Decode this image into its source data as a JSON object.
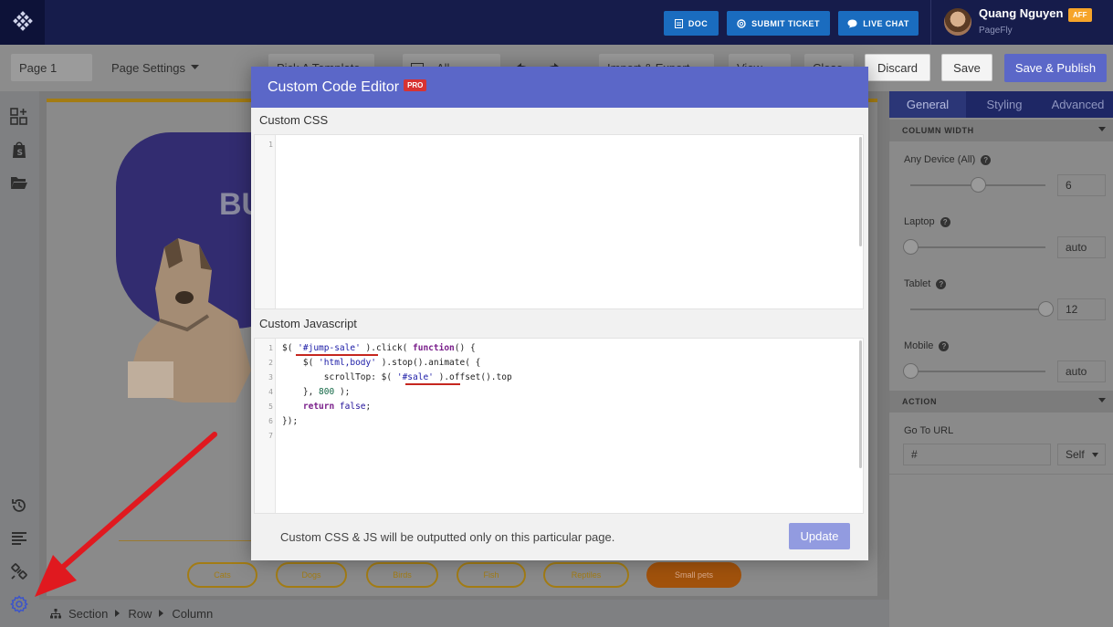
{
  "topnav": {
    "doc_label": "DOC",
    "ticket_label": "SUBMIT TICKET",
    "chat_label": "LIVE CHAT",
    "user_name": "Quang Nguyen",
    "aff_badge": "AFF",
    "user_sub": "PageFly"
  },
  "toolbar": {
    "page_name": "Page 1",
    "page_settings": "Page Settings",
    "pick_template": "Pick A Template",
    "device_select": "All",
    "import_export": "Import & Export",
    "view": "View",
    "close": "Close",
    "discard": "Discard",
    "save": "Save",
    "save_publish": "Save & Publish"
  },
  "canvas": {
    "hero_text": "BU",
    "categories": [
      "Cats",
      "Dogs",
      "Birds",
      "Fish",
      "Reptiles",
      "Small pets"
    ],
    "active_category": "Small pets"
  },
  "breadcrumb": [
    "Section",
    "Row",
    "Column"
  ],
  "right_panel": {
    "tabs": [
      "General",
      "Styling",
      "Advanced"
    ],
    "column_width_title": "COLUMN WIDTH",
    "devices": [
      {
        "label": "Any Device (All)",
        "value": "6",
        "level": 0.5
      },
      {
        "label": "Laptop",
        "value": "auto",
        "level": 0
      },
      {
        "label": "Tablet",
        "value": "12",
        "level": 1
      },
      {
        "label": "Mobile",
        "value": "auto",
        "level": 0
      }
    ],
    "action_title": "ACTION",
    "goto_label": "Go To URL",
    "url_value": "#",
    "target_value": "Self"
  },
  "modal": {
    "title": "Custom Code Editor",
    "pro_badge": "PRO",
    "css_label": "Custom CSS",
    "js_label": "Custom Javascript",
    "css_line_numbers": [
      "1"
    ],
    "js_line_numbers": [
      "1",
      "2",
      "3",
      "4",
      "5",
      "6",
      "7"
    ],
    "footer_text": "Custom CSS & JS will be outputted only on this particular page.",
    "update_label": "Update",
    "js_code": {
      "l1_a": "$( ",
      "l1_str": "'#jump-sale'",
      "l1_b": " ).click( ",
      "l1_kw": "function",
      "l1_c": "() {",
      "l2_a": "    $( ",
      "l2_str": "'html,body'",
      "l2_b": " ).stop().animate( {",
      "l3_a": "        scrollTop: $( ",
      "l3_str": "'#sale'",
      "l3_b": " ).offset().top",
      "l4_a": "    }, ",
      "l4_num": "800",
      "l4_b": " );",
      "l5_kw": "    return",
      "l5_atom": " false",
      "l5_b": ";",
      "l6": "});"
    }
  },
  "colors": {
    "topnav_bg": "#161c4b",
    "accent": "#5b67c8",
    "button_blue": "#1a6cbf",
    "annotation_red": "#e0191f"
  }
}
